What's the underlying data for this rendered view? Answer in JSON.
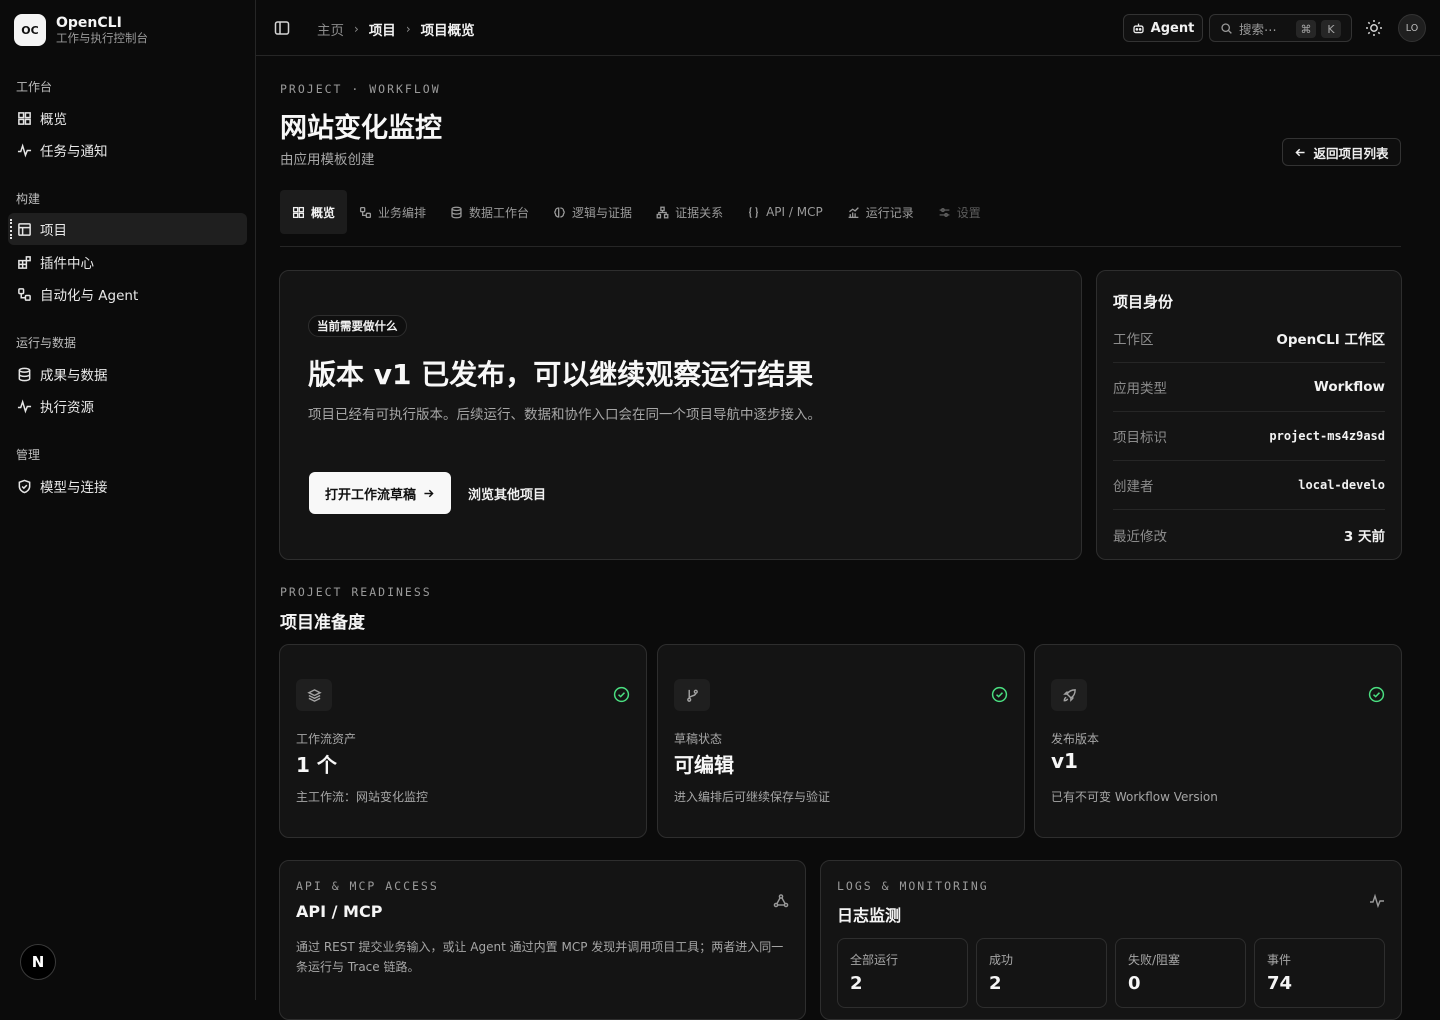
{
  "brand": {
    "logo": "OC",
    "name": "OpenCLI",
    "subtitle": "工作与执行控制台"
  },
  "sidebar": {
    "groups": [
      {
        "title": "工作台",
        "items": [
          {
            "label": "概览",
            "icon": "grid-icon"
          },
          {
            "label": "任务与通知",
            "icon": "activity-icon"
          }
        ]
      },
      {
        "title": "构建",
        "items": [
          {
            "label": "项目",
            "icon": "layout-icon",
            "active": true
          },
          {
            "label": "插件中心",
            "icon": "blocks-icon"
          },
          {
            "label": "自动化与 Agent",
            "icon": "workflow-icon"
          }
        ]
      },
      {
        "title": "运行与数据",
        "items": [
          {
            "label": "成果与数据",
            "icon": "database-icon"
          },
          {
            "label": "执行资源",
            "icon": "activity-icon"
          }
        ]
      },
      {
        "title": "管理",
        "items": [
          {
            "label": "模型与连接",
            "icon": "shield-icon"
          }
        ]
      }
    ],
    "footer_badge": "N"
  },
  "topbar": {
    "breadcrumb": [
      "主页",
      "项目",
      "项目概览"
    ],
    "agent_label": "Agent",
    "search_placeholder": "搜索⋯",
    "shortcut_keys": [
      "⌘",
      "K"
    ],
    "avatar": "LO"
  },
  "page": {
    "eyebrow": "PROJECT · WORKFLOW",
    "title": "网站变化监控",
    "subtitle": "由应用模板创建",
    "back_button": "返回项目列表"
  },
  "tabs": [
    {
      "label": "概览",
      "icon": "grid-icon",
      "active": true
    },
    {
      "label": "业务编排",
      "icon": "workflow-icon"
    },
    {
      "label": "数据工作台",
      "icon": "database-icon"
    },
    {
      "label": "逻辑与证据",
      "icon": "brain-icon"
    },
    {
      "label": "证据关系",
      "icon": "network-icon"
    },
    {
      "label": "API / MCP",
      "icon": "braces-icon"
    },
    {
      "label": "运行记录",
      "icon": "chart-icon"
    },
    {
      "label": "设置",
      "icon": "settings-icon",
      "disabled": true
    }
  ],
  "hero": {
    "pill": "当前需要做什么",
    "title": "版本 v1 已发布，可以继续观察运行结果",
    "description": "项目已经有可执行版本。后续运行、数据和协作入口会在同一个项目导航中逐步接入。",
    "primary_button": "打开工作流草稿",
    "secondary_button": "浏览其他项目"
  },
  "identity": {
    "title": "项目身份",
    "rows": [
      {
        "label": "工作区",
        "value": "OpenCLI 工作区",
        "mono": false
      },
      {
        "label": "应用类型",
        "value": "Workflow",
        "mono": false
      },
      {
        "label": "项目标识",
        "value": "project-ms4z9asd",
        "mono": true
      },
      {
        "label": "创建者",
        "value": "local-develo",
        "mono": true
      },
      {
        "label": "最近修改",
        "value": "3 天前",
        "mono": false
      }
    ]
  },
  "readiness": {
    "eyebrow": "PROJECT READINESS",
    "title": "项目准备度",
    "cards": [
      {
        "icon": "layers-icon",
        "label": "工作流资产",
        "value": "1 个",
        "description": "主工作流：网站变化监控",
        "status": "ok"
      },
      {
        "icon": "git-branch-icon",
        "label": "草稿状态",
        "value": "可编辑",
        "description": "进入编排后可继续保存与验证",
        "status": "ok"
      },
      {
        "icon": "rocket-icon",
        "label": "发布版本",
        "value": "v1",
        "description": "已有不可变 Workflow Version",
        "status": "ok"
      }
    ]
  },
  "api": {
    "eyebrow": "API & MCP ACCESS",
    "title": "API / MCP",
    "description": "通过 REST 提交业务输入，或让 Agent 通过内置 MCP 发现并调用项目工具；两者进入同一条运行与 Trace 链路。"
  },
  "logs": {
    "eyebrow": "LOGS & MONITORING",
    "title": "日志监测",
    "stats": [
      {
        "label": "全部运行",
        "value": "2"
      },
      {
        "label": "成功",
        "value": "2"
      },
      {
        "label": "失败/阻塞",
        "value": "0"
      },
      {
        "label": "事件",
        "value": "74"
      }
    ]
  },
  "colors": {
    "background": "#0b0b0b",
    "card": "#141414",
    "border": "#2e2e2e",
    "success": "#4ade80"
  }
}
